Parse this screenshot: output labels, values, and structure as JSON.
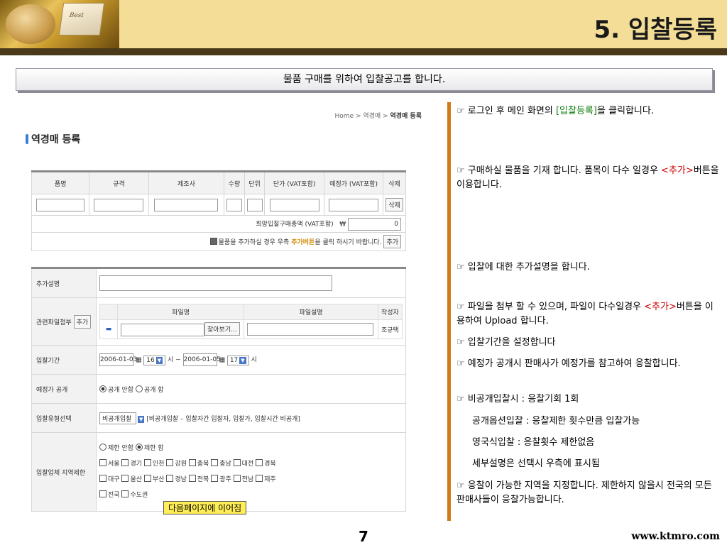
{
  "header": {
    "title": "5. 입찰등록",
    "photo_key_text": "Best"
  },
  "subtitle": "물품 구매를 위하여 입찰공고를 합니다.",
  "screenshot": {
    "breadcrumb": [
      "Home",
      "역경매",
      "역경매 등록"
    ],
    "page_title": "역경매 등록",
    "item_table": {
      "columns": [
        "품명",
        "규격",
        "제조사",
        "수량",
        "단위",
        "단가 (VAT포함)",
        "예정가 (VAT포함)",
        "삭제"
      ],
      "delete_label": "삭제",
      "total_label": "희망입찰구매총액 (VAT포함)",
      "currency": "₩",
      "total_value": "0",
      "add_note_pre": "물품을 추가하실 경우 우측 ",
      "add_note_hl": "추가버튼",
      "add_note_post": "을 클릭 하시기 바랍니다.",
      "add_label": "추가"
    },
    "form": {
      "extra_desc_label": "추가설명",
      "attach_label": "관련파일첨부",
      "attach_add": "추가",
      "file_cols": [
        "파일명",
        "파일설명",
        "작성자"
      ],
      "browse": "찾아보기...",
      "author": "조규택",
      "period_label": "입찰기간",
      "start_date": "2006-01-03",
      "start_hour": "16",
      "hour_unit": "시",
      "tilde": "~",
      "end_date": "2006-01-05",
      "end_hour": "17",
      "reveal_label": "예정가 공개",
      "reveal_no": "공개 안함",
      "reveal_yes": "공개 함",
      "type_label": "입찰유형선택",
      "type_value": "비공개입찰",
      "type_desc": "[비공개입찰 – 입찰자간 입찰자, 입찰가, 입찰시간 비공개]",
      "region_label": "입찰업체 지역제한",
      "region_no": "제한 안함",
      "region_yes": "제한 함",
      "regions_row1": [
        "서울",
        "경기",
        "인천",
        "강원",
        "충북",
        "충남",
        "대전",
        "경북"
      ],
      "regions_row2": [
        "대구",
        "울산",
        "부산",
        "경남",
        "전북",
        "광주",
        "전남",
        "제주"
      ],
      "regions_row3": [
        "전국",
        "수도권"
      ]
    },
    "continued": "다음페이지에 이어짐"
  },
  "notes": {
    "n1_pre": "☞ 로그인 후 메인 화면의 ",
    "n1_hl": "[입찰등록]",
    "n1_post": "을 클릭합니다.",
    "n2_pre": "☞ 구매하실 물품을 기재 합니다. 품목이 다수 일경우 ",
    "n2_hl": "<추가>",
    "n2_post": "버튼을 이용합니다.",
    "n3": "☞ 입찰에 대한 추가설명을 합니다.",
    "n4_pre": "☞ 파일을 첨부 할 수 있으며, 파일이 다수일경우 ",
    "n4_hl": "<추가>",
    "n4_post": "버튼을 이용하여 Upload 합니다.",
    "n5": "☞ 입찰기간을 설정합니다",
    "n6": "☞ 예정가 공개시 판매사가 예정가를 참고하여 응찰합니다.",
    "n7": "☞ 비공개입찰시 : 응찰기회 1회",
    "n7a": "공개옵션입찰 : 응찰제한 횟수만큼 입찰가능",
    "n7b": "영국식입찰 : 응찰횟수 제한없음",
    "n7c": "세부설명은 선택시 우측에 표시됨",
    "n8": "☞ 응찰이 가능한 지역을 지정합니다. 제한하지 않을시 전국의 모든 판매사들이 응찰가능합니다."
  },
  "page_number": "7",
  "footer_url": "www.ktmro.com"
}
